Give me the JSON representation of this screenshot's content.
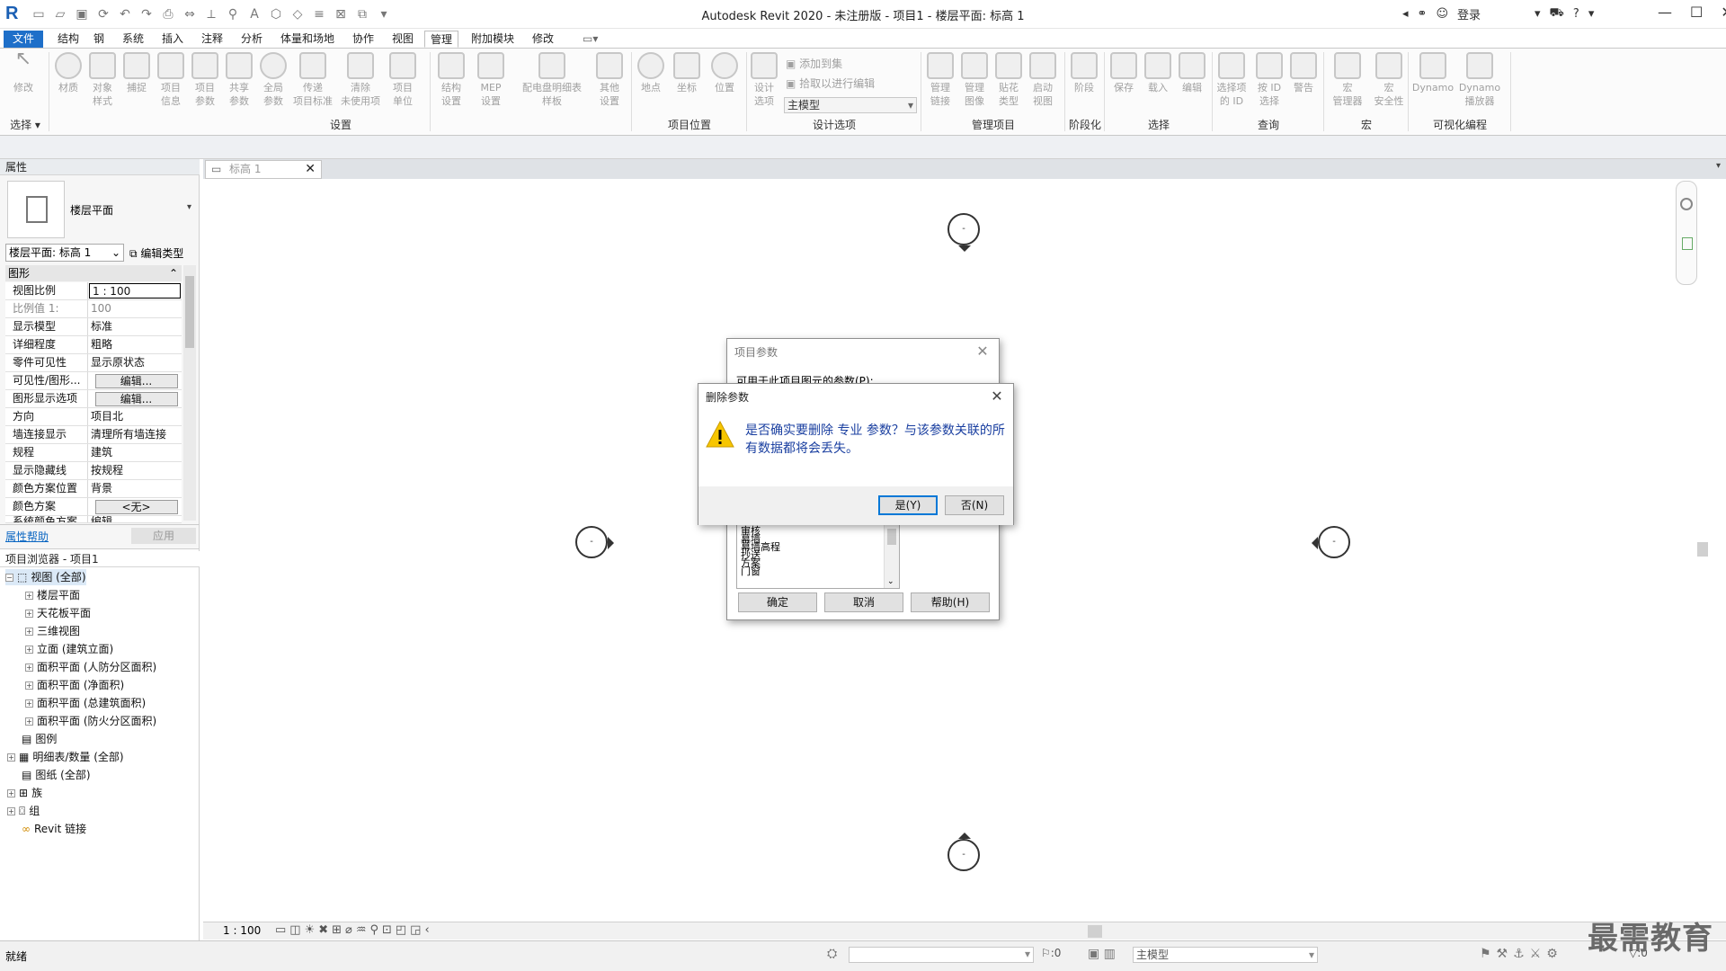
{
  "app": {
    "title": "Autodesk Revit 2020 - 未注册版 - 项目1 - 楼层平面: 标高 1",
    "login": "登录",
    "logo": "R"
  },
  "menu": [
    "文件",
    "结构",
    "钢",
    "系统",
    "插入",
    "注释",
    "分析",
    "体量和场地",
    "协作",
    "视图",
    "管理",
    "附加模块",
    "修改"
  ],
  "ribbon": {
    "buttons": [
      {
        "label": "修改"
      },
      {
        "label": "材质"
      },
      {
        "label": "对象\n样式"
      },
      {
        "label": "捕捉"
      },
      {
        "label": "项目\n信息"
      },
      {
        "label": "项目\n参数"
      },
      {
        "label": "共享\n参数"
      },
      {
        "label": "全局\n参数"
      },
      {
        "label": "传递\n项目标准"
      },
      {
        "label": "清除\n未使用项"
      },
      {
        "label": "项目\n单位"
      },
      {
        "label": "结构\n设置"
      },
      {
        "label": "MEP\n设置"
      },
      {
        "label": "配电盘明细表\n样板"
      },
      {
        "label": "其他\n设置"
      },
      {
        "label": "地点"
      },
      {
        "label": "坐标"
      },
      {
        "label": "位置"
      },
      {
        "label": "设计\n选项"
      },
      {
        "label": "管理\n链接"
      },
      {
        "label": "管理\n图像"
      },
      {
        "label": "贴花\n类型"
      },
      {
        "label": "启动\n视图"
      },
      {
        "label": "阶段"
      },
      {
        "label": "保存"
      },
      {
        "label": "载入"
      },
      {
        "label": "编辑"
      },
      {
        "label": "选择项\n的 ID"
      },
      {
        "label": "按 ID\n选择"
      },
      {
        "label": "警告"
      },
      {
        "label": "宏\n管理器"
      },
      {
        "label": "宏\n安全性"
      },
      {
        "label": "Dynamo"
      },
      {
        "label": "Dynamo\n播放器"
      }
    ],
    "design_option_add": "添加到集",
    "design_option_pick": "拾取以进行编辑",
    "design_option_select": "主模型",
    "panels": [
      "选择",
      "设置",
      "项目位置",
      "设计选项",
      "管理项目",
      "阶段化",
      "选择",
      "查询",
      "宏",
      "可视化编程"
    ]
  },
  "properties": {
    "header": "属性",
    "type_name": "楼层平面",
    "instance_select": "楼层平面: 标高 1",
    "edit_type": "编辑类型",
    "group": "图形",
    "rows": [
      {
        "k": "视图比例",
        "v": "1 : 100"
      },
      {
        "k": "比例值 1:",
        "v": "100"
      },
      {
        "k": "显示模型",
        "v": "标准"
      },
      {
        "k": "详细程度",
        "v": "粗略"
      },
      {
        "k": "零件可见性",
        "v": "显示原状态"
      },
      {
        "k": "可见性/图形...",
        "v": "编辑..."
      },
      {
        "k": "图形显示选项",
        "v": "编辑..."
      },
      {
        "k": "方向",
        "v": "项目北"
      },
      {
        "k": "墙连接显示",
        "v": "清理所有墙连接"
      },
      {
        "k": "规程",
        "v": "建筑"
      },
      {
        "k": "显示隐藏线",
        "v": "按规程"
      },
      {
        "k": "颜色方案位置",
        "v": "背景"
      },
      {
        "k": "颜色方案",
        "v": "<无>"
      },
      {
        "k": "系统颜色方案",
        "v": "编辑..."
      }
    ],
    "help_link": "属性帮助",
    "apply": "应用"
  },
  "browser": {
    "header": "项目浏览器 - 项目1",
    "items": [
      {
        "label": "视图 (全部)",
        "level": 0,
        "sign": "-",
        "selected": true
      },
      {
        "label": "楼层平面",
        "level": 1,
        "sign": "+"
      },
      {
        "label": "天花板平面",
        "level": 1,
        "sign": "+"
      },
      {
        "label": "三维视图",
        "level": 1,
        "sign": "+"
      },
      {
        "label": "立面 (建筑立面)",
        "level": 1,
        "sign": "+"
      },
      {
        "label": "面积平面 (人防分区面积)",
        "level": 1,
        "sign": "+"
      },
      {
        "label": "面积平面 (净面积)",
        "level": 1,
        "sign": "+"
      },
      {
        "label": "面积平面 (总建筑面积)",
        "level": 1,
        "sign": "+"
      },
      {
        "label": "面积平面 (防火分区面积)",
        "level": 1,
        "sign": "+"
      },
      {
        "label": "图例",
        "level": 0,
        "sign": ""
      },
      {
        "label": "明细表/数量 (全部)",
        "level": 0,
        "sign": "+"
      },
      {
        "label": "图纸 (全部)",
        "level": 0,
        "sign": ""
      },
      {
        "label": "族",
        "level": 0,
        "sign": "+"
      },
      {
        "label": "组",
        "level": 0,
        "sign": "+"
      },
      {
        "label": "Revit 链接",
        "level": 0,
        "sign": ""
      }
    ]
  },
  "view": {
    "tab": "标高 1",
    "scale": "1 : 100"
  },
  "project_params_dialog": {
    "title": "项目参数",
    "label": "可用于此项目图元的参数(P):",
    "list": [
      "审核",
      "幕墙",
      "幕墙高程",
      "抄送",
      "方案",
      "门窗"
    ],
    "ok": "确定",
    "cancel": "取消",
    "help": "帮助(H)"
  },
  "delete_dialog": {
    "title": "删除参数",
    "message": "是否确实要删除 专业 参数？与该参数关联的所有数据都将会丢失。",
    "yes": "是(Y)",
    "no": "否(N)"
  },
  "status": {
    "text": "就绪",
    "workset_value": ":0",
    "model_select": "主模型",
    "filter_value": ":0"
  },
  "watermark": "最需教育"
}
